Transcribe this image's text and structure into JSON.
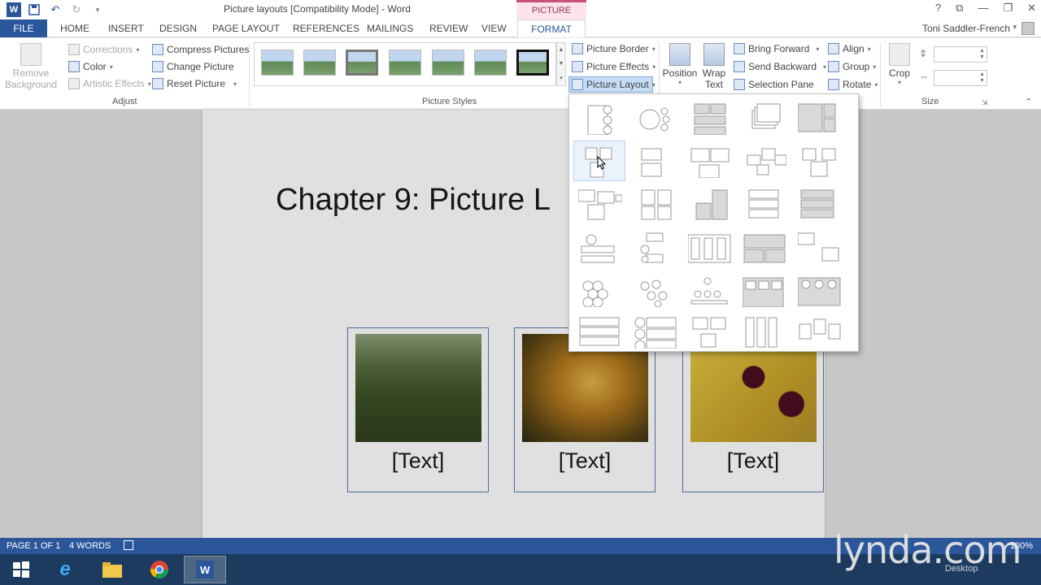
{
  "window": {
    "title": "Picture layouts [Compatibility Mode] - Word",
    "context_tab_group": "PICTURE TOOLS",
    "user": "Toni Saddler-French",
    "controls": [
      "?",
      "⧉",
      "—",
      "❐",
      "✕"
    ]
  },
  "tabs": [
    "FILE",
    "HOME",
    "INSERT",
    "DESIGN",
    "PAGE LAYOUT",
    "REFERENCES",
    "MAILINGS",
    "REVIEW",
    "VIEW",
    "FORMAT"
  ],
  "active_tab": "FORMAT",
  "ribbon": {
    "adjust": {
      "remove_background_line1": "Remove",
      "remove_background_line2": "Background",
      "corrections": "Corrections",
      "color": "Color",
      "artistic_effects": "Artistic Effects",
      "compress": "Compress Pictures",
      "change": "Change Picture",
      "reset": "Reset Picture",
      "label": "Adjust"
    },
    "picture_styles": {
      "label": "Picture Styles",
      "border": "Picture Border",
      "effects": "Picture Effects",
      "layout": "Picture Layout"
    },
    "arrange": {
      "position": "Position",
      "wrap_line1": "Wrap",
      "wrap_line2": "Text",
      "bring_forward": "Bring Forward",
      "send_backward": "Send Backward",
      "selection_pane": "Selection Pane",
      "align": "Align",
      "group": "Group",
      "rotate": "Rotate"
    },
    "size": {
      "crop": "Crop",
      "label": "Size"
    }
  },
  "document": {
    "heading": "Chapter 9: Picture L",
    "cards": [
      {
        "caption": "[Text]"
      },
      {
        "caption": "[Text]"
      },
      {
        "caption": "[Text]"
      }
    ]
  },
  "layout_menu": {
    "rows": 6,
    "cols": 5,
    "hovered_index": 5
  },
  "statusbar": {
    "page": "PAGE 1 OF 1",
    "words": "4 WORDS",
    "zoom": "100%"
  },
  "taskbar": {
    "desktop_label": "Desktop",
    "watermark": "lynda.com"
  }
}
